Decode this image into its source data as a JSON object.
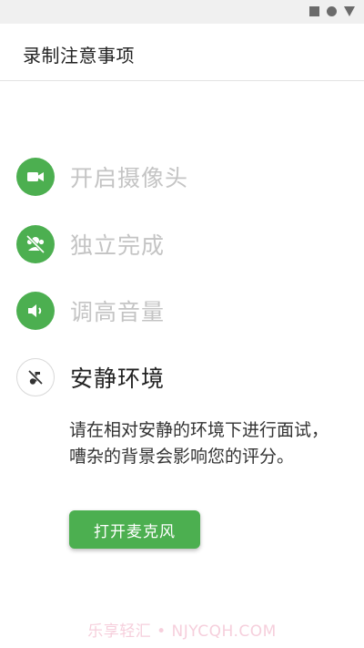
{
  "status_bar": {
    "icons": [
      "square-icon",
      "circle-icon",
      "triangle-icon"
    ]
  },
  "header": {
    "title": "录制注意事项"
  },
  "steps": [
    {
      "label": "开启摄像头",
      "icon": "video-camera-icon",
      "state": "done"
    },
    {
      "label": "独立完成",
      "icon": "no-people-icon",
      "state": "done"
    },
    {
      "label": "调高音量",
      "icon": "volume-icon",
      "state": "done"
    },
    {
      "label": "安静环境",
      "icon": "music-off-icon",
      "state": "current"
    }
  ],
  "description": "请在相对安静的环境下进行面试，嘈杂的背景会影响您的评分。",
  "actions": {
    "open_mic_label": "打开麦克风"
  },
  "watermark": "乐享轻汇 • NJYCQH.COM",
  "colors": {
    "accent": "#4caf50",
    "muted_text": "#c4c4c4",
    "primary_text": "#222222"
  }
}
